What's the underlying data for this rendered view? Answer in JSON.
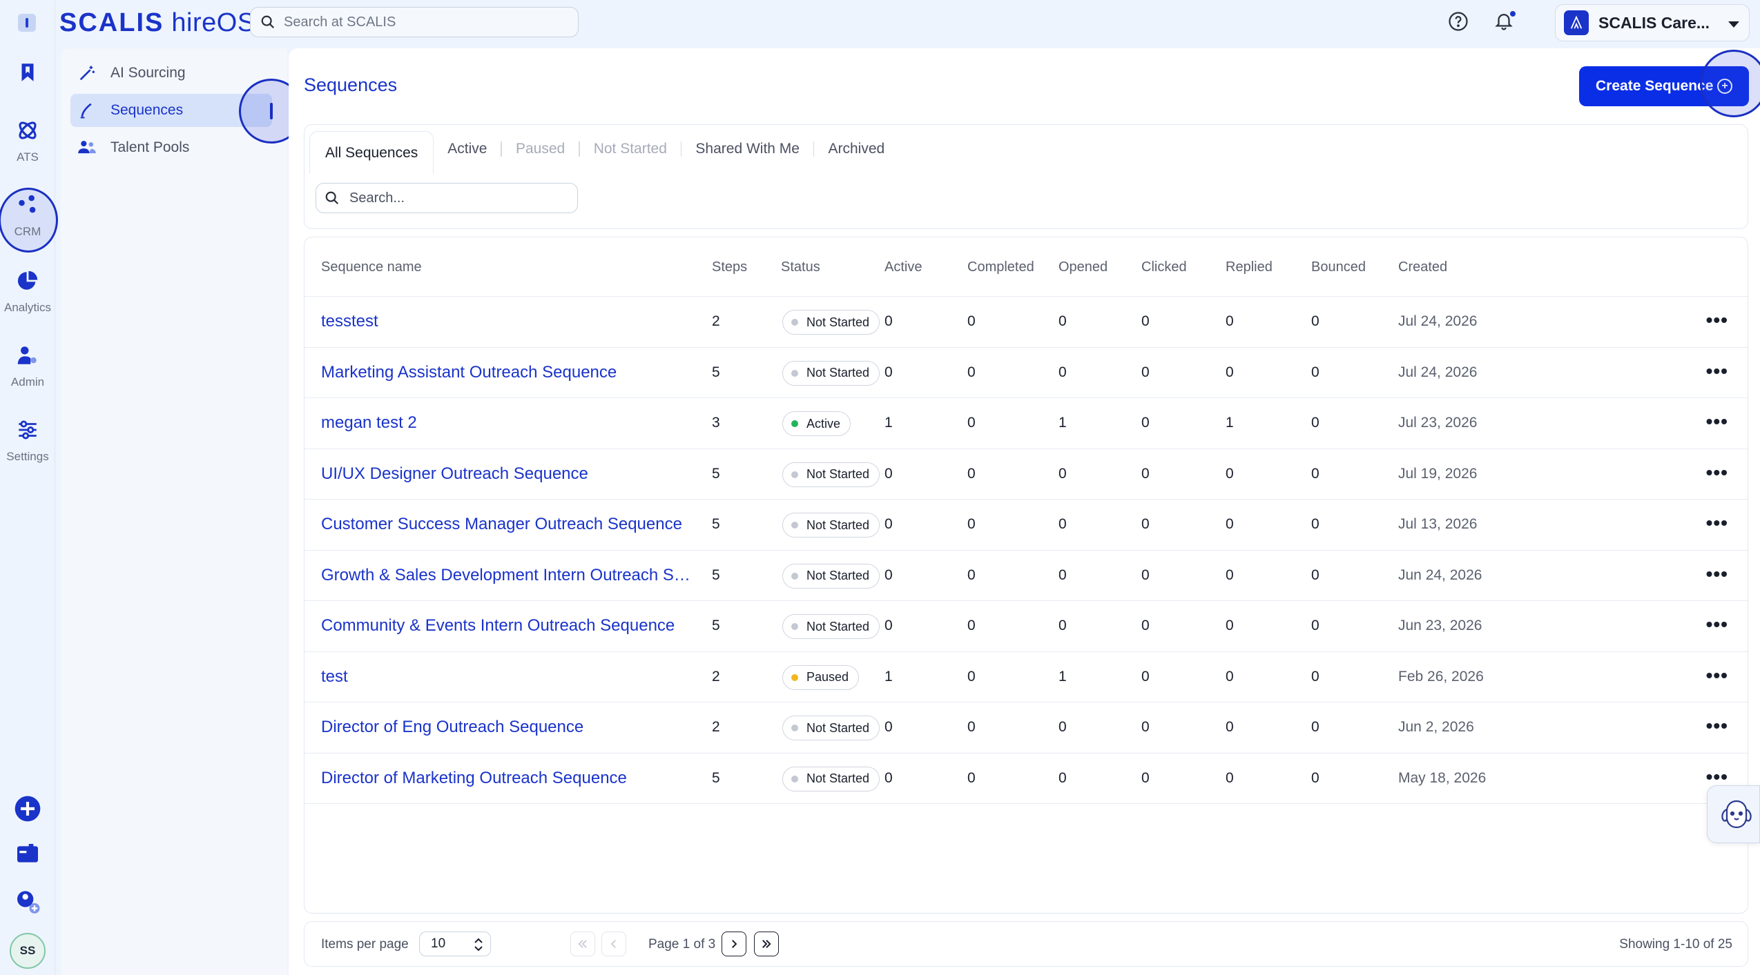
{
  "brand": {
    "strong": "SCALIS",
    "light": "hireOS"
  },
  "header": {
    "search_placeholder": "Search at SCALIS",
    "org_name": "SCALIS Care..."
  },
  "rail": {
    "items": [
      {
        "label": "ATS",
        "icon": "atom-icon"
      },
      {
        "label": "CRM",
        "icon": "crm-dots-icon"
      },
      {
        "label": "Analytics",
        "icon": "pie-chart-icon"
      },
      {
        "label": "Admin",
        "icon": "admin-user-gear-icon"
      },
      {
        "label": "Settings",
        "icon": "sliders-icon"
      }
    ],
    "user_initials": "SS"
  },
  "subnav": {
    "items": [
      {
        "label": "AI Sourcing",
        "icon": "magic-wand-icon"
      },
      {
        "label": "Sequences",
        "icon": "pen-icon",
        "active": true
      },
      {
        "label": "Talent Pools",
        "icon": "users-icon"
      }
    ]
  },
  "page": {
    "title": "Sequences",
    "create_button": "Create Sequence"
  },
  "tabs": [
    {
      "label": "All Sequences",
      "state": "active"
    },
    {
      "label": "Active",
      "state": "enabled"
    },
    {
      "label": "Paused",
      "state": "disabled"
    },
    {
      "label": "Not Started",
      "state": "disabled"
    },
    {
      "label": "Shared With Me",
      "state": "enabled"
    },
    {
      "label": "Archived",
      "state": "enabled"
    }
  ],
  "table_search_placeholder": "Search...",
  "columns": [
    "Sequence name",
    "Steps",
    "Status",
    "Active",
    "Completed",
    "Opened",
    "Clicked",
    "Replied",
    "Bounced",
    "Created"
  ],
  "status_colors": {
    "Not Started": "#c3c8d2",
    "Active": "#22b45a",
    "Paused": "#f2b71f"
  },
  "rows": [
    {
      "name": "tesstest",
      "steps": "2",
      "status": "Not Started",
      "active": "0",
      "completed": "0",
      "opened": "0",
      "clicked": "0",
      "replied": "0",
      "bounced": "0",
      "created": "Jul 24, 2026"
    },
    {
      "name": "Marketing Assistant Outreach Sequence",
      "steps": "5",
      "status": "Not Started",
      "active": "0",
      "completed": "0",
      "opened": "0",
      "clicked": "0",
      "replied": "0",
      "bounced": "0",
      "created": "Jul 24, 2026"
    },
    {
      "name": "megan test 2",
      "steps": "3",
      "status": "Active",
      "active": "1",
      "completed": "0",
      "opened": "1",
      "clicked": "0",
      "replied": "1",
      "bounced": "0",
      "created": "Jul 23, 2026"
    },
    {
      "name": "UI/UX Designer Outreach Sequence",
      "steps": "5",
      "status": "Not Started",
      "active": "0",
      "completed": "0",
      "opened": "0",
      "clicked": "0",
      "replied": "0",
      "bounced": "0",
      "created": "Jul 19, 2026"
    },
    {
      "name": "Customer Success Manager Outreach Sequence",
      "steps": "5",
      "status": "Not Started",
      "active": "0",
      "completed": "0",
      "opened": "0",
      "clicked": "0",
      "replied": "0",
      "bounced": "0",
      "created": "Jul 13, 2026"
    },
    {
      "name": "Growth & Sales Development Intern Outreach Se...",
      "steps": "5",
      "status": "Not Started",
      "active": "0",
      "completed": "0",
      "opened": "0",
      "clicked": "0",
      "replied": "0",
      "bounced": "0",
      "created": "Jun 24, 2026"
    },
    {
      "name": "Community & Events Intern Outreach Sequence",
      "steps": "5",
      "status": "Not Started",
      "active": "0",
      "completed": "0",
      "opened": "0",
      "clicked": "0",
      "replied": "0",
      "bounced": "0",
      "created": "Jun 23, 2026"
    },
    {
      "name": "test",
      "steps": "2",
      "status": "Paused",
      "active": "1",
      "completed": "0",
      "opened": "1",
      "clicked": "0",
      "replied": "0",
      "bounced": "0",
      "created": "Feb 26, 2026"
    },
    {
      "name": "Director of Eng Outreach Sequence",
      "steps": "2",
      "status": "Not Started",
      "active": "0",
      "completed": "0",
      "opened": "0",
      "clicked": "0",
      "replied": "0",
      "bounced": "0",
      "created": "Jun 2, 2026"
    },
    {
      "name": "Director of Marketing Outreach Sequence",
      "steps": "5",
      "status": "Not Started",
      "active": "0",
      "completed": "0",
      "opened": "0",
      "clicked": "0",
      "replied": "0",
      "bounced": "0",
      "created": "May 18, 2026"
    }
  ],
  "pagination": {
    "items_per_page_label": "Items per page",
    "items_per_page": "10",
    "page_text": "Page 1 of 3",
    "showing": "Showing 1-10 of 25"
  }
}
